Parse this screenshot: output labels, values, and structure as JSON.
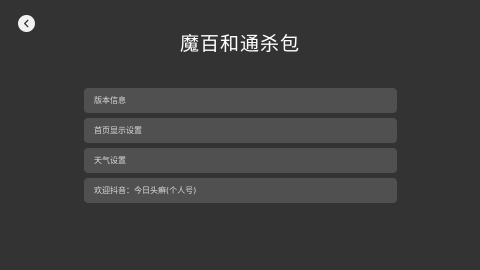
{
  "header": {
    "back_icon": "chevron-left-icon",
    "title": "魔百和通杀包"
  },
  "menu": {
    "items": [
      {
        "label": "版本信息"
      },
      {
        "label": "首页显示设置"
      },
      {
        "label": "天气设置"
      },
      {
        "label": "欢迎抖音：今日头癣(个人号)"
      }
    ]
  },
  "colors": {
    "background": "#333333",
    "item_background": "#505050",
    "title": "#ffffff",
    "item_text": "#d9d9d9",
    "back_button": "#f2f2f2"
  }
}
